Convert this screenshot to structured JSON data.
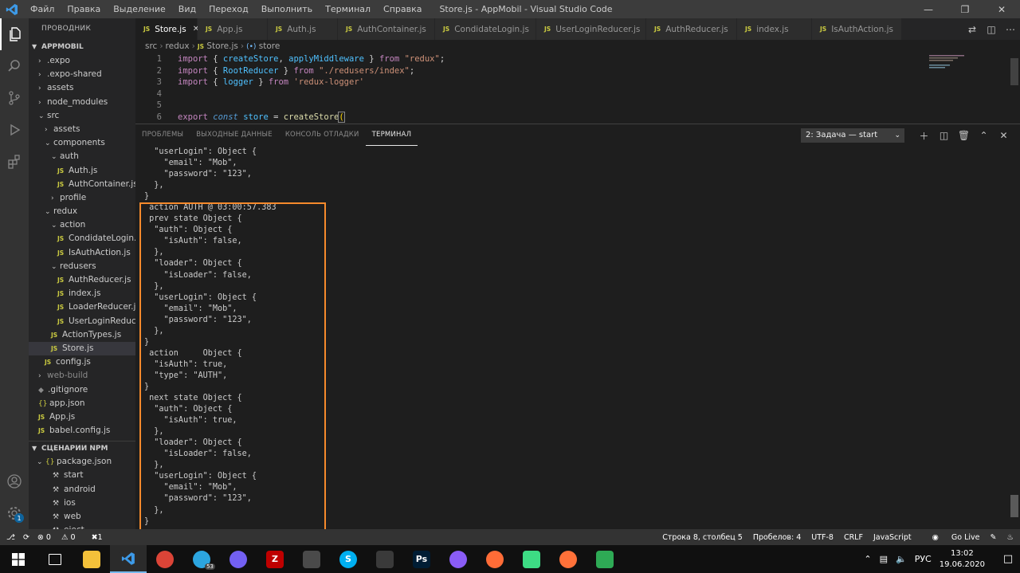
{
  "titlebar": {
    "menu": [
      "Файл",
      "Правка",
      "Выделение",
      "Вид",
      "Переход",
      "Выполнить",
      "Терминал",
      "Справка"
    ],
    "window_title": "Store.js - AppMobil - Visual Studio Code"
  },
  "sidebar": {
    "header": "ПРОВОДНИК",
    "project": "APPMOBIL",
    "tree": [
      {
        "label": ".expo",
        "depth": 1,
        "kind": "folder",
        "open": false
      },
      {
        "label": ".expo-shared",
        "depth": 1,
        "kind": "folder",
        "open": false
      },
      {
        "label": "assets",
        "depth": 1,
        "kind": "folder",
        "open": false
      },
      {
        "label": "node_modules",
        "depth": 1,
        "kind": "folder",
        "open": false
      },
      {
        "label": "src",
        "depth": 1,
        "kind": "folder",
        "open": true
      },
      {
        "label": "assets",
        "depth": 2,
        "kind": "folder",
        "open": false
      },
      {
        "label": "components",
        "depth": 2,
        "kind": "folder",
        "open": true
      },
      {
        "label": "auth",
        "depth": 3,
        "kind": "folder",
        "open": true
      },
      {
        "label": "Auth.js",
        "depth": 4,
        "kind": "js"
      },
      {
        "label": "AuthContainer.js",
        "depth": 4,
        "kind": "js"
      },
      {
        "label": "profile",
        "depth": 3,
        "kind": "folder",
        "open": false
      },
      {
        "label": "redux",
        "depth": 2,
        "kind": "folder",
        "open": true
      },
      {
        "label": "action",
        "depth": 3,
        "kind": "folder",
        "open": true
      },
      {
        "label": "CondidateLogin.js",
        "depth": 4,
        "kind": "js"
      },
      {
        "label": "IsAuthAction.js",
        "depth": 4,
        "kind": "js"
      },
      {
        "label": "redusers",
        "depth": 3,
        "kind": "folder",
        "open": true
      },
      {
        "label": "AuthReducer.js",
        "depth": 4,
        "kind": "js"
      },
      {
        "label": "index.js",
        "depth": 4,
        "kind": "js"
      },
      {
        "label": "LoaderReducer.js",
        "depth": 4,
        "kind": "js"
      },
      {
        "label": "UserLoginReduce...",
        "depth": 4,
        "kind": "js"
      },
      {
        "label": "ActionTypes.js",
        "depth": 3,
        "kind": "js"
      },
      {
        "label": "Store.js",
        "depth": 3,
        "kind": "js",
        "selected": true
      },
      {
        "label": "config.js",
        "depth": 2,
        "kind": "js"
      },
      {
        "label": "web-build",
        "depth": 1,
        "kind": "folder",
        "open": false,
        "muted": true
      },
      {
        "label": ".gitignore",
        "depth": 1,
        "kind": "git"
      },
      {
        "label": "app.json",
        "depth": 1,
        "kind": "json"
      },
      {
        "label": "App.js",
        "depth": 1,
        "kind": "js"
      },
      {
        "label": "babel.config.js",
        "depth": 1,
        "kind": "js"
      }
    ],
    "npm_header": "СЦЕНАРИИ NPM",
    "npm_package": "package.json",
    "npm_scripts": [
      "start",
      "android",
      "ios",
      "web",
      "eject"
    ]
  },
  "tabs": [
    {
      "label": "Store.js",
      "active": true,
      "width": 78
    },
    {
      "label": "App.js",
      "width": 88
    },
    {
      "label": "Auth.js",
      "width": 88
    },
    {
      "label": "AuthContainer.js",
      "width": 122
    },
    {
      "label": "CondidateLogin.js",
      "width": 127
    },
    {
      "label": "UserLoginReducer.js",
      "width": 138
    },
    {
      "label": "AuthReducer.js",
      "width": 114
    },
    {
      "label": "index.js",
      "width": 94
    },
    {
      "label": "IsAuthAction.js",
      "width": 113
    }
  ],
  "breadcrumb": {
    "parts": [
      "src",
      "redux",
      "Store.js"
    ],
    "symbol": "store",
    "js_icon": "JS"
  },
  "editor": {
    "line_numbers": [
      "1",
      "2",
      "3",
      "4",
      "5",
      "6"
    ]
  },
  "panel": {
    "tabs": [
      "ПРОБЛЕМЫ",
      "ВЫХОДНЫЕ ДАННЫЕ",
      "КОНСОЛЬ ОТЛАДКИ",
      "ТЕРМИНАЛ"
    ],
    "active_tab": "ТЕРМИНАЛ",
    "terminal_select": "2: Задача — start",
    "terminal_lines": [
      "  \"userLogin\": Object {",
      "    \"email\": \"Mob\",",
      "    \"password\": \"123\",",
      "  },",
      "}",
      " action AUTH @ 03:00:57.383",
      " prev state Object {",
      "  \"auth\": Object {",
      "    \"isAuth\": false,",
      "  },",
      "  \"loader\": Object {",
      "    \"isLoader\": false,",
      "  },",
      "  \"userLogin\": Object {",
      "    \"email\": \"Mob\",",
      "    \"password\": \"123\",",
      "  },",
      "}",
      " action     Object {",
      "  \"isAuth\": true,",
      "  \"type\": \"AUTH\",",
      "}",
      " next state Object {",
      "  \"auth\": Object {",
      "    \"isAuth\": true,",
      "  },",
      "  \"loader\": Object {",
      "    \"isLoader\": false,",
      "  },",
      "  \"userLogin\": Object {",
      "    \"email\": \"Mob\",",
      "    \"password\": \"123\",",
      "  },",
      "}"
    ]
  },
  "status": {
    "left_errors": "0",
    "left_warnings": "0",
    "left_extra": "1",
    "position": "Строка 8, столбец 5",
    "spaces": "Пробелов: 4",
    "encoding": "UTF-8",
    "eol": "CRLF",
    "language": "JavaScript",
    "golive": "Go Live"
  },
  "taskbar": {
    "apps": [
      {
        "name": "task-view",
        "label": "",
        "color": "#101010"
      },
      {
        "name": "explorer",
        "label": "",
        "color": "#f3c13a"
      },
      {
        "name": "vscode",
        "label": "",
        "color": "#2b2b2b",
        "active": true
      },
      {
        "name": "chrome",
        "label": "",
        "color": "#db4437"
      },
      {
        "name": "telegram",
        "label": "",
        "color": "#2ca5e0",
        "badge": "53"
      },
      {
        "name": "viber",
        "label": "",
        "color": "#7360f2"
      },
      {
        "name": "filezilla",
        "label": "Z",
        "color": "#bf0000"
      },
      {
        "name": "calculator",
        "label": "",
        "color": "#4a4a4a"
      },
      {
        "name": "skype",
        "label": "S",
        "color": "#00aff0"
      },
      {
        "name": "paint",
        "label": "",
        "color": "#3a3a3a"
      },
      {
        "name": "photoshop",
        "label": "Ps",
        "color": "#001d34"
      },
      {
        "name": "postman-like",
        "label": "",
        "color": "#8a5cf6"
      },
      {
        "name": "postman",
        "label": "",
        "color": "#ff6c37"
      },
      {
        "name": "android-studio",
        "label": "",
        "color": "#3ddc84"
      },
      {
        "name": "firefox",
        "label": "",
        "color": "#ff7139"
      },
      {
        "name": "green-app",
        "label": "",
        "color": "#2eaa55"
      }
    ],
    "lang": "РУС",
    "time": "13:02",
    "date": "19.06.2020"
  },
  "colors": {
    "accent_orange": "#f58a2c",
    "vscode_blue": "#007acc"
  }
}
